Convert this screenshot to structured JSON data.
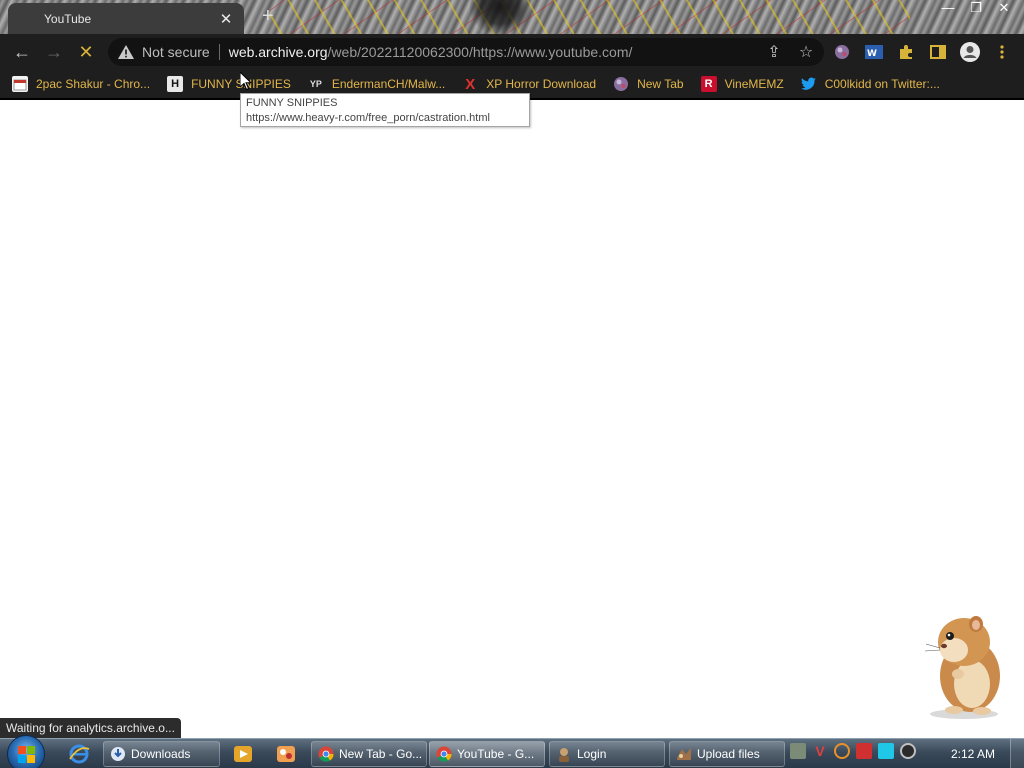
{
  "tab": {
    "title": "YouTube",
    "close": "✕",
    "new_tab": "+"
  },
  "window_controls": {
    "minimize": "—",
    "maximize": "❐",
    "close": "✕"
  },
  "toolbar": {
    "back": "←",
    "forward": "→",
    "reload": "✕",
    "security_label": "Not secure",
    "url_host": "web.archive.org",
    "url_path": "/web/20221120062300/https://www.youtube.com/"
  },
  "bookmarks": [
    {
      "label": "2pac Shakur - Chro...",
      "icon": "folder-calendar-icon",
      "color": "#c0392b"
    },
    {
      "label": "FUNNY SNIPPIES",
      "icon": "h-logo-icon",
      "color": "#2b2b2b"
    },
    {
      "label": "EndermanCH/Malw...",
      "icon": "yp-logo-icon",
      "color": "#2b2b2b"
    },
    {
      "label": "XP Horror Download",
      "icon": "x-logo-icon",
      "color": "#e03030"
    },
    {
      "label": "New Tab",
      "icon": "globe-icon",
      "color": "#8a6f9e"
    },
    {
      "label": "VineMEMZ",
      "icon": "r-logo-icon",
      "color": "#c8102e"
    },
    {
      "label": "C00lkidd on Twitter:...",
      "icon": "twitter-icon",
      "color": "#1d9bf0"
    }
  ],
  "tooltip": {
    "title": "FUNNY SNIPPIES",
    "url": "https://www.heavy-r.com/free_porn/castration.html"
  },
  "status_text": "Waiting for analytics.archive.o...",
  "taskbar": {
    "buttons": [
      {
        "label": "Downloads",
        "icon": "explorer-icon",
        "color": "#e6c35c"
      },
      {
        "label": "New Tab - Go...",
        "icon": "chrome-icon",
        "color": "#4caf50"
      },
      {
        "label": "YouTube - G...",
        "icon": "chrome-icon",
        "color": "#4caf50"
      },
      {
        "label": "Login",
        "icon": "login-app-icon",
        "color": "#b58b55"
      },
      {
        "label": "Upload files",
        "icon": "upload-app-icon",
        "color": "#a07048"
      }
    ],
    "clock": "2:12 AM"
  }
}
